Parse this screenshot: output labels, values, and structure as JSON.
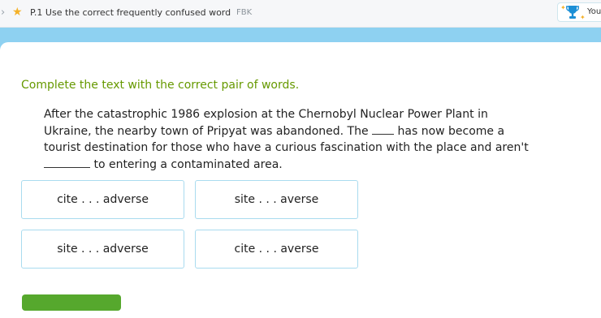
{
  "header": {
    "skill_title": "P.1 Use the correct frequently confused word",
    "skill_code": "FBK",
    "award_label": "You"
  },
  "question": {
    "instruction": "Complete the text with the correct pair of words.",
    "passage": {
      "line1": "After the catastrophic 1986 explosion at the Chernobyl Nuclear Power Plant in",
      "line2_pre": "Ukraine, the nearby town of Pripyat was abandoned. The ",
      "line2_post": " has now become a",
      "line3": "tourist destination for those who have a curious fascination with the place and aren't",
      "line4_post": " to entering a contaminated area."
    }
  },
  "choices": [
    {
      "label": "cite . . . adverse"
    },
    {
      "label": "site . . . averse"
    },
    {
      "label": "site . . . adverse"
    },
    {
      "label": "cite . . . averse"
    }
  ],
  "colors": {
    "instruction": "#669900",
    "band": "#8ed1f1",
    "choice_border": "#a9dbef",
    "submit": "#56a82d",
    "star": "#f4b128"
  }
}
